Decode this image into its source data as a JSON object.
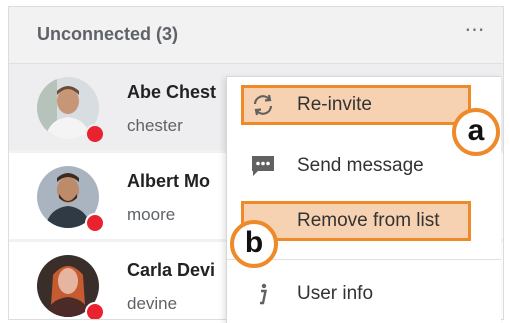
{
  "header": {
    "title": "Unconnected (3)",
    "more_icon": "more-horizontal-icon",
    "more_glyph": "⋯"
  },
  "contacts": [
    {
      "name": "Abe Chest",
      "username": "chester",
      "status_color": "#e8232f",
      "avatar_colors": [
        "#d8dde2",
        "#c69676",
        "#6b4a36",
        "#9fb2a0"
      ]
    },
    {
      "name": "Albert Mo",
      "username": "moore",
      "status_color": "#e8232f",
      "avatar_colors": [
        "#aab4c0",
        "#bd8a6a",
        "#3b2a20",
        "#2f3a44"
      ]
    },
    {
      "name": "Carla Devi",
      "username": "devine",
      "status_color": "#e8232f",
      "avatar_colors": [
        "#3a2e2a",
        "#e5b5a0",
        "#c65b32",
        "#4c2a28"
      ]
    }
  ],
  "context_menu": {
    "items": [
      {
        "label": "Re-invite",
        "icon": "refresh-icon"
      },
      {
        "label": "Send message",
        "icon": "chat-message-icon"
      },
      {
        "label": "Remove from list",
        "icon": "none"
      },
      {
        "label": "User info",
        "icon": "info-icon"
      }
    ]
  },
  "annotations": {
    "a": "a",
    "b": "b",
    "highlight_fill": "#f7d2b2",
    "highlight_border": "#ee8a2a"
  }
}
